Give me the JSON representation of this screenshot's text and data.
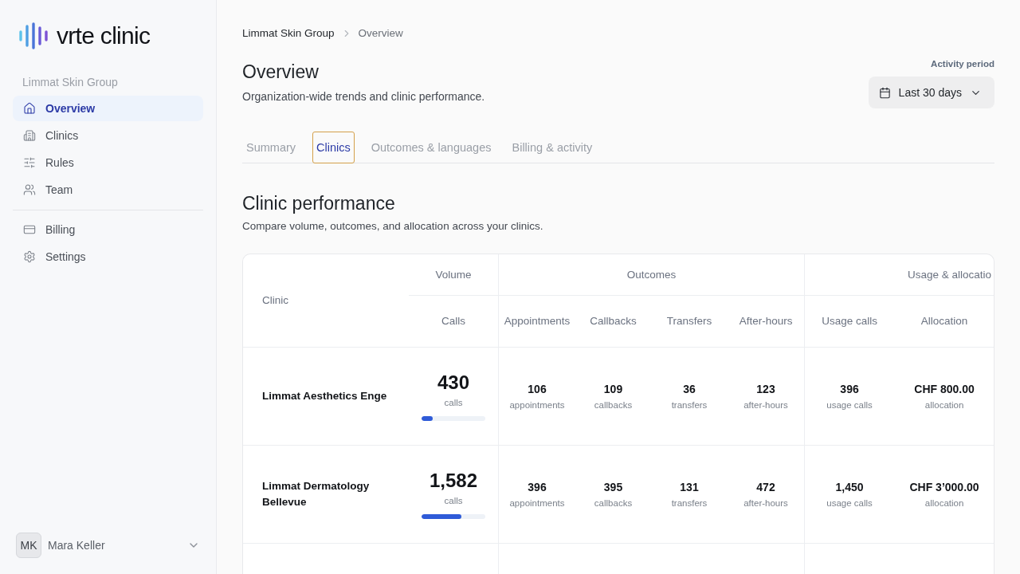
{
  "sidebar": {
    "logo": {
      "text": "vrte clinic"
    },
    "org_label": "Limmat Skin Group",
    "nav_main": [
      {
        "label": "Overview",
        "selected": true
      },
      {
        "label": "Clinics",
        "selected": false
      },
      {
        "label": "Rules",
        "selected": false
      },
      {
        "label": "Team",
        "selected": false
      }
    ],
    "nav_secondary": [
      {
        "label": "Billing",
        "selected": false
      },
      {
        "label": "Settings",
        "selected": false
      }
    ],
    "user": {
      "initials": "MK",
      "name": "Mara Keller"
    }
  },
  "breadcrumb": [
    "Limmat Skin Group",
    "Overview"
  ],
  "header": {
    "title": "Overview",
    "subtitle": "Organization-wide trends and clinic performance.",
    "period": {
      "label": "Activity period",
      "value": "Last 30 days"
    }
  },
  "tabs": [
    {
      "label": "Summary",
      "selected": false
    },
    {
      "label": "Clinics",
      "selected": true
    },
    {
      "label": "Outcomes & languages",
      "selected": false
    },
    {
      "label": "Billing & activity",
      "selected": false
    }
  ],
  "section": {
    "title": "Clinic performance",
    "description": "Compare volume, outcomes, and allocation across your clinics."
  },
  "table": {
    "clinic_heading": "Clinic",
    "groups": [
      {
        "label": "Volume",
        "columns": [
          "Calls"
        ]
      },
      {
        "label": "Outcomes",
        "columns": [
          "Appointments",
          "Callbacks",
          "Transfers",
          "After-hours"
        ]
      },
      {
        "label": "Usage & allocatio",
        "columns": [
          "Usage calls",
          "Allocation"
        ]
      }
    ],
    "rows": [
      {
        "clinic": "Limmat Aesthetics Enge",
        "calls": {
          "value": "430",
          "unit": "calls",
          "level": 0.17
        },
        "cells": [
          {
            "value": "106",
            "unit": "appointments"
          },
          {
            "value": "109",
            "unit": "callbacks"
          },
          {
            "value": "36",
            "unit": "transfers"
          },
          {
            "value": "123",
            "unit": "after-hours"
          },
          {
            "value": "396",
            "unit": "usage calls"
          },
          {
            "value": "CHF 800.00",
            "unit": "allocation"
          }
        ]
      },
      {
        "clinic": "Limmat Dermatology Bellevue",
        "calls": {
          "value": "1,582",
          "unit": "calls",
          "level": 0.62
        },
        "cells": [
          {
            "value": "396",
            "unit": "appointments"
          },
          {
            "value": "395",
            "unit": "callbacks"
          },
          {
            "value": "131",
            "unit": "transfers"
          },
          {
            "value": "472",
            "unit": "after-hours"
          },
          {
            "value": "1,450",
            "unit": "usage calls"
          },
          {
            "value": "CHF 3’000.00",
            "unit": "allocation"
          }
        ]
      }
    ]
  }
}
